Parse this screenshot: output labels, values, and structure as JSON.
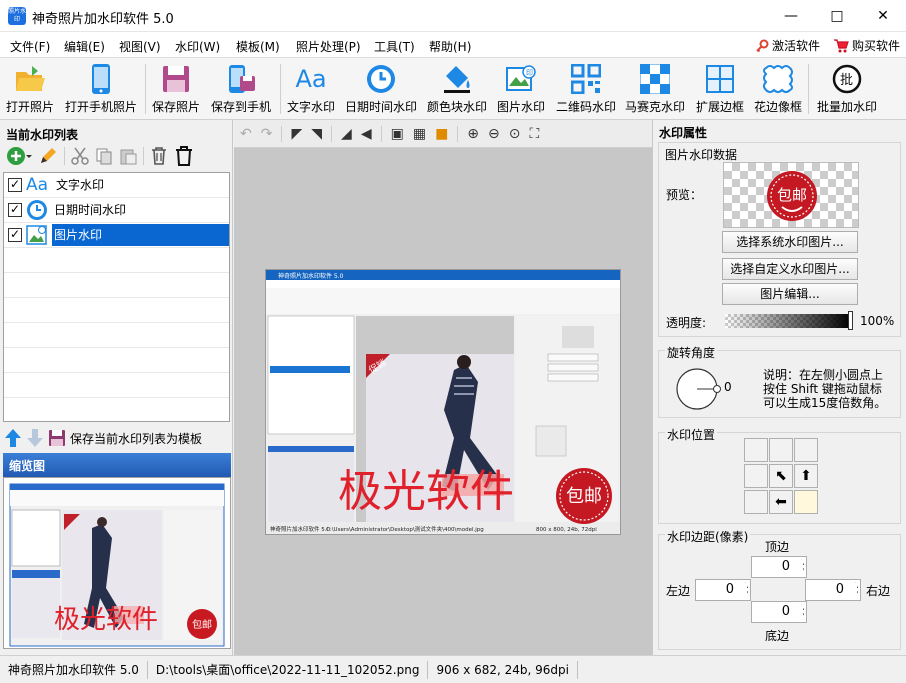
{
  "window": {
    "title": "神奇照片加水印软件 5.0",
    "icon_text": "照片水印"
  },
  "menu": {
    "items": [
      "文件(F)",
      "编辑(E)",
      "视图(V)",
      "水印(W)",
      "模板(M)",
      "照片处理(P)",
      "工具(T)",
      "帮助(H)"
    ],
    "activate": "激活软件",
    "buy": "购买软件"
  },
  "toolbar": {
    "items": [
      "打开照片",
      "打开手机照片",
      "保存照片",
      "保存到手机",
      "文字水印",
      "日期时间水印",
      "颜色块水印",
      "图片水印",
      "二维码水印",
      "马赛克水印",
      "扩展边框",
      "花边像框",
      "批量加水印"
    ]
  },
  "left": {
    "list_title": "当前水印列表",
    "watermarks": [
      {
        "label": "文字水印",
        "checked": true,
        "icon": "text-aa-icon"
      },
      {
        "label": "日期时间水印",
        "checked": true,
        "icon": "clock-icon"
      },
      {
        "label": "图片水印",
        "checked": true,
        "icon": "image-icon",
        "selected": true
      }
    ],
    "save_template": "保存当前水印列表为模板",
    "thumb_title": "缩览图"
  },
  "preview": {
    "title": "神奇照片加水印软件 5.0",
    "watermark_text": "极光软件",
    "stamp_text": "包邮",
    "corner_text": "促销",
    "status_left": "神奇照片加水印软件 5.0",
    "status_path": "C:\\Users\\Administrator\\Desktop\\测试文件夹\\400\\model.jpg",
    "status_info": "800 x 800, 24b, 72dpi"
  },
  "right": {
    "title": "水印属性",
    "image_wm_title": "图片水印数据",
    "preview_label": "预览：",
    "stamp_text": "包邮",
    "btn_system": "选择系统水印图片...",
    "btn_custom": "选择自定义水印图片...",
    "btn_edit": "图片编辑...",
    "opacity_label": "透明度:",
    "opacity_value": "100%",
    "opacity": 1.0,
    "rotate_title": "旋转角度",
    "rotate_value": "0",
    "rotate_note": "说明：在左侧小圆点上按住 Shift 键拖动鼠标可以生成15度倍数角。",
    "position_title": "水印位置",
    "margin_title": "水印边距(像素)",
    "top_label": "顶边",
    "left_label": "左边",
    "right_label": "右边",
    "bottom_label": "底边",
    "top": "0",
    "left": "0",
    "right": "0",
    "bottom": "0"
  },
  "status": {
    "app": "神奇照片加水印软件 5.0",
    "path": "D:\\tools\\桌面\\office\\2022-11-11_102052.png",
    "info": "906 x 682, 24b, 96dpi"
  }
}
